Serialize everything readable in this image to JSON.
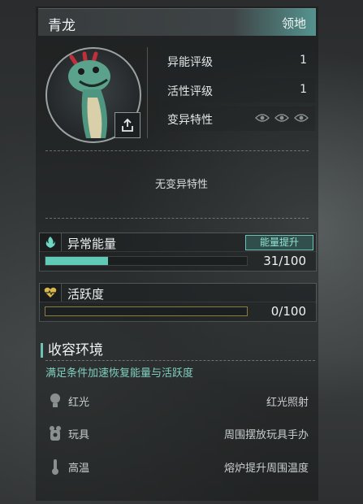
{
  "header": {
    "name": "青龙",
    "tag": "领地"
  },
  "stats": [
    {
      "label": "异能评级",
      "value": "1"
    },
    {
      "label": "活性评级",
      "value": "1"
    },
    {
      "label": "变异特性",
      "icons": [
        "eye-icon",
        "eye-icon",
        "eye-icon"
      ]
    }
  ],
  "mutation_text": "无变异特性",
  "energy": {
    "title": "异常能量",
    "boost_label": "能量提升",
    "value_text": "31/100",
    "current": 31,
    "max": 100,
    "color": "#5fcab6",
    "icon": "flame-icon"
  },
  "activity": {
    "title": "活跃度",
    "value_text": "0/100",
    "current": 0,
    "max": 100,
    "color": "#b8a24a",
    "icon": "heart-pulse-icon"
  },
  "environment": {
    "title": "收容环境",
    "subtitle": "满足条件加速恢复能量与活跃度",
    "rows": [
      {
        "name": "红光",
        "desc": "红光照射",
        "icon": "bulb-icon"
      },
      {
        "name": "玩具",
        "desc": "周围摆放玩具手办",
        "icon": "toy-icon"
      },
      {
        "name": "高温",
        "desc": "熔炉提升周围温度",
        "icon": "thermometer-icon"
      }
    ]
  },
  "colors": {
    "accent": "#6fc2b3",
    "bar_activity": "#b8a24a"
  }
}
